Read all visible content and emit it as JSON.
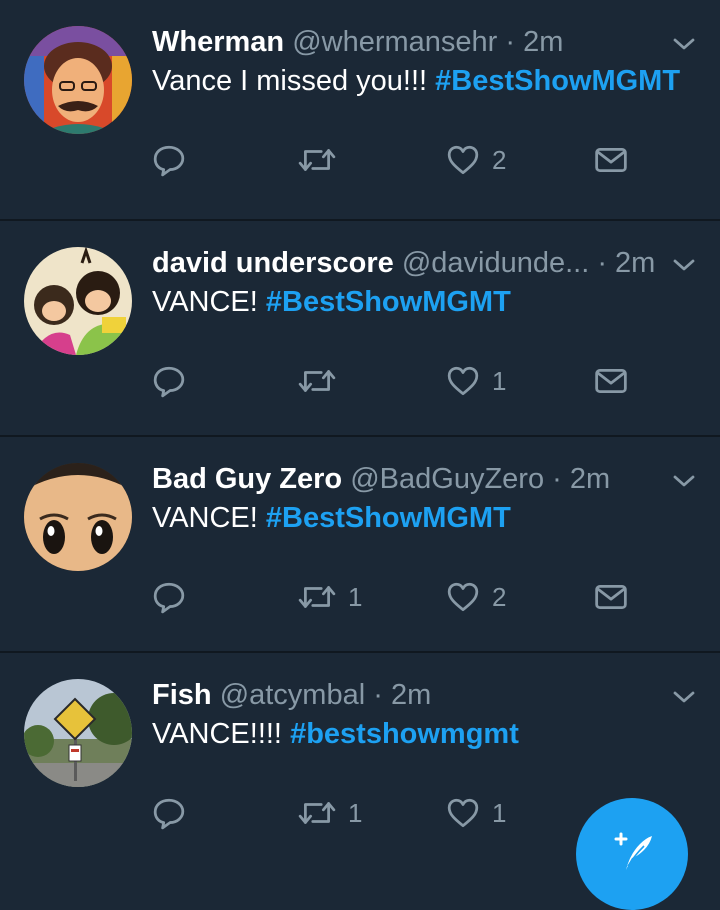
{
  "tweets": [
    {
      "name": "Wherman",
      "handle": "@whermansehr",
      "time": "2m",
      "text": "Vance I missed you!!! ",
      "hashtag": "#BestShowMGMT",
      "retweets": "",
      "likes": "2"
    },
    {
      "name": "david underscore",
      "handle": "@davidunde...",
      "time": "2m",
      "text": "VANCE! ",
      "hashtag": "#BestShowMGMT",
      "retweets": "",
      "likes": "1"
    },
    {
      "name": "Bad Guy Zero",
      "handle": "@BadGuyZero",
      "time": "2m",
      "text": "VANCE! ",
      "hashtag": "#BestShowMGMT",
      "retweets": "1",
      "likes": "2"
    },
    {
      "name": "Fish",
      "handle": "@atcymbal",
      "time": "2m",
      "text": "VANCE!!!! ",
      "hashtag": "#bestshowmgmt",
      "retweets": "1",
      "likes": "1"
    }
  ],
  "dot": " · ",
  "icons": {
    "reply": "reply-icon",
    "retweet": "retweet-icon",
    "like": "heart-icon",
    "dm": "envelope-icon",
    "menu": "chevron-down-icon",
    "compose": "compose-tweet-icon"
  },
  "colors": {
    "background": "#1b2836",
    "accent": "#1da1f2",
    "secondary_text": "#8899a6",
    "divider": "#101820"
  }
}
